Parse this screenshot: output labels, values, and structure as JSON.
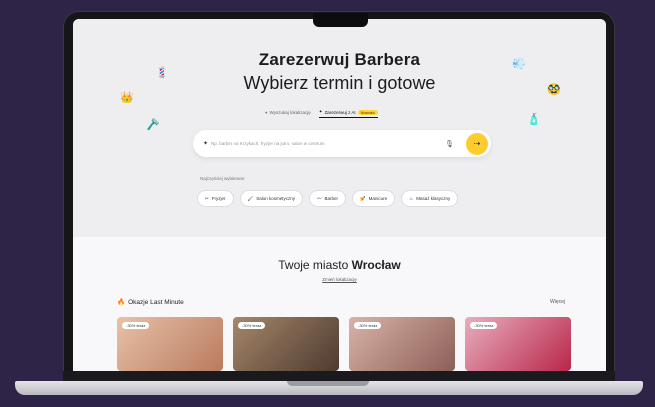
{
  "hero": {
    "title": "Zarezerwuj Barbera",
    "subtitle": "Wybierz termin i gotowe",
    "tabs": [
      {
        "label": "Wyszukaj lokalizację",
        "active": false
      },
      {
        "label": "Zarezerwuj z AI",
        "active": true,
        "badge": "Nowość"
      }
    ]
  },
  "search": {
    "placeholder": "Np. barber na Krzykach, fryzjer na jutro, salon w centrum"
  },
  "popular": {
    "label": "Najczęściej wybierane",
    "chips": [
      {
        "label": "Fryzjer",
        "icon": "scissors-icon"
      },
      {
        "label": "Salon kosmetyczny",
        "icon": "brush-icon"
      },
      {
        "label": "Barber",
        "icon": "mustache-icon"
      },
      {
        "label": "Manicure",
        "icon": "nail-icon"
      },
      {
        "label": "Masaż klasyczny",
        "icon": "massage-icon"
      }
    ]
  },
  "city": {
    "prefix": "Twoje miasto",
    "name": "Wrocław",
    "change_label": "Zmień lokalizację"
  },
  "lastminute": {
    "title": "Okazje Last Minute",
    "more_label": "Więcej",
    "cards": [
      {
        "badge": "-30% teraz",
        "color": "#d9a585"
      },
      {
        "badge": "-30% teraz",
        "color": "#8a6a52"
      },
      {
        "badge": "-30% teraz",
        "color": "#c29688"
      },
      {
        "badge": "-30% teraz",
        "color": "#c53a5a"
      }
    ]
  },
  "colors": {
    "accent": "#ffcb2e",
    "background": "#2e2447"
  }
}
